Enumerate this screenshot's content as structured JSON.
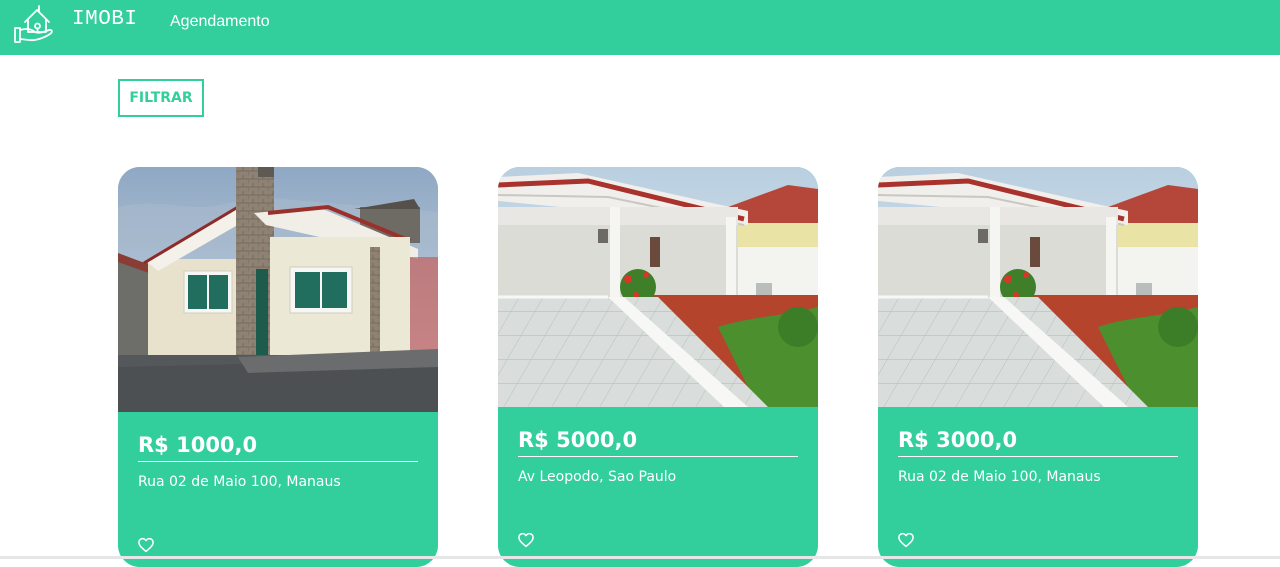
{
  "header": {
    "brand": "IMOBI",
    "nav": [
      {
        "label": "Agendamento"
      }
    ],
    "icon": "house-in-hand-icon",
    "color": "#32cf9c"
  },
  "filter": {
    "label": "FILTRAR"
  },
  "listings": [
    {
      "price": "R$ 1000,0",
      "address": "Rua 02 de Maio 100, Manaus",
      "image": "house-photo",
      "favorite_icon": "heart-icon"
    },
    {
      "price": "R$ 5000,0",
      "address": "Av Leopodo, Sao Paulo",
      "image": "house-photo",
      "favorite_icon": "heart-icon"
    },
    {
      "price": "R$ 3000,0",
      "address": "Rua 02 de Maio 100, Manaus",
      "image": "house-photo",
      "favorite_icon": "heart-icon"
    }
  ]
}
